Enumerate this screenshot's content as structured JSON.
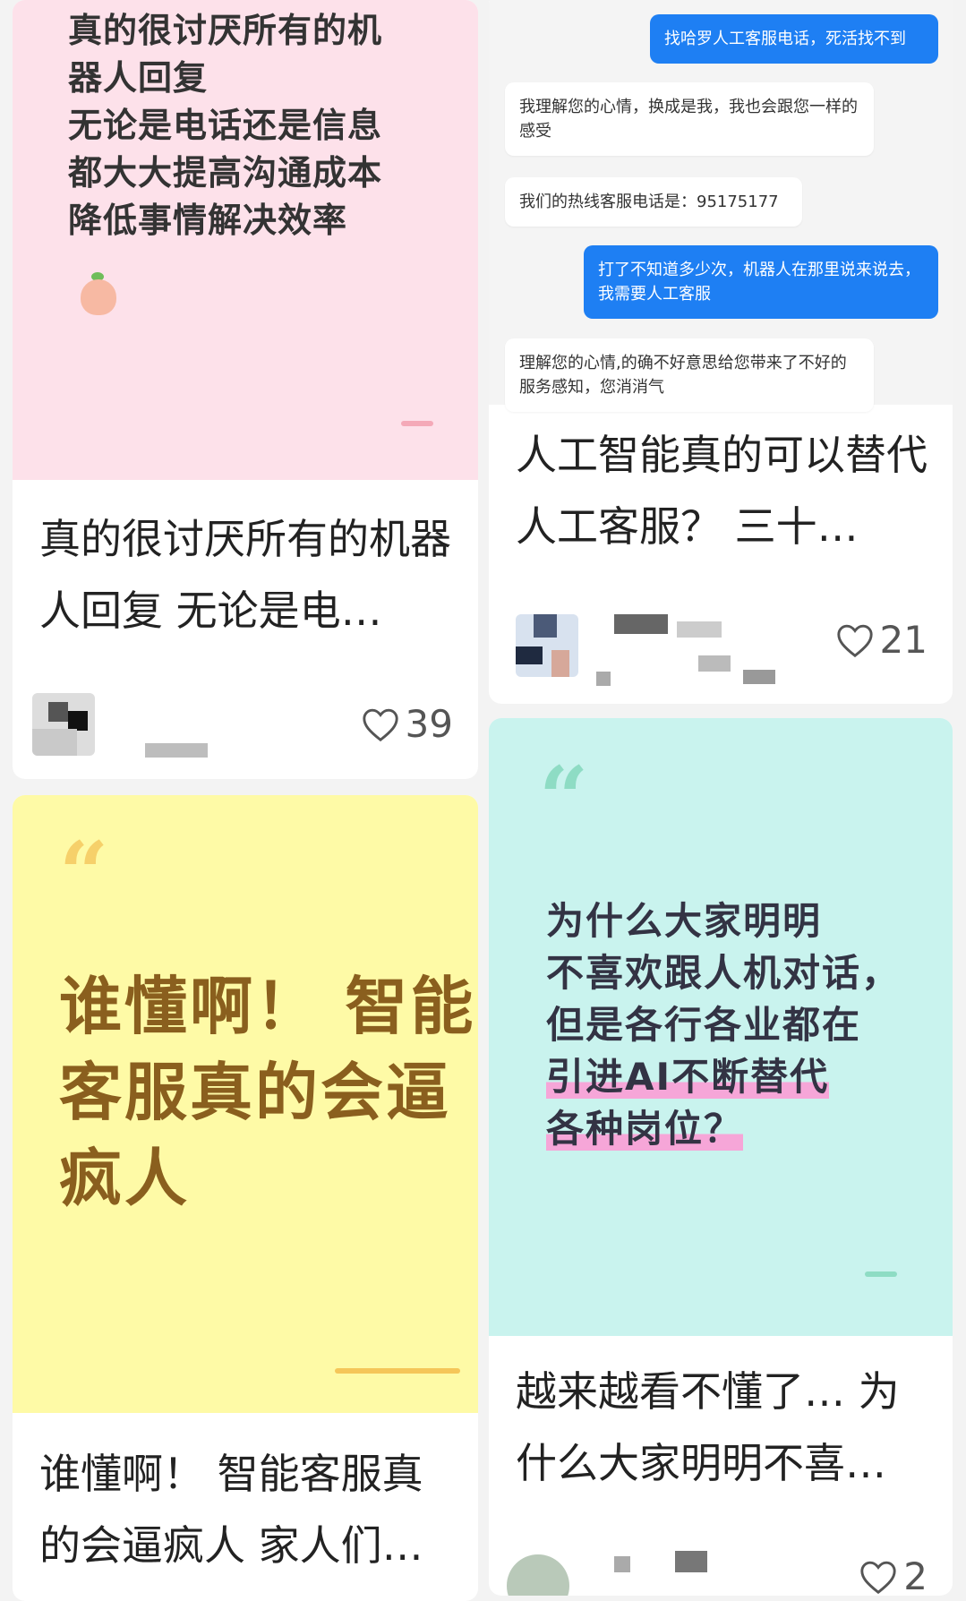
{
  "cards": [
    {
      "cover_lines": [
        "真的很讨厌所有的机",
        "器人回复",
        "无论是电话还是信息",
        "都大大提高沟通成本",
        " 降低事情解决效率"
      ],
      "title": "真的很讨厌所有的机器人回复 无论是电…",
      "likes": "39"
    },
    {
      "chat": [
        {
          "from": "me",
          "text": "找哈罗人工客服电话，死活找不到"
        },
        {
          "from": "bot",
          "text": "我理解您的心情，换成是我，我也会跟您一样的感受"
        },
        {
          "from": "bot",
          "text": "我们的热线客服电话是：95175177"
        },
        {
          "from": "me",
          "text": "打了不知道多少次，机器人在那里说来说去，我需要人工客服"
        },
        {
          "from": "bot",
          "text": "理解您的心情,的确不好意思给您带来了不好的服务感知，您消消气"
        }
      ],
      "title": "人工智能真的可以替代人工客服？ 三十…",
      "likes": "21"
    },
    {
      "cover_lines": [
        "谁懂啊！ 智能",
        "客服真的会逼",
        "疯人"
      ],
      "title": "谁懂啊！ 智能客服真的会逼疯人 家人们…",
      "colors": {
        "bg": "#fefaa6",
        "text": "#8a5f1e"
      }
    },
    {
      "cover_lines": [
        "为什么大家明明",
        "不喜欢跟人机对话，",
        "但是各行各业都在",
        "引进AI不断替代",
        "各种岗位？"
      ],
      "title": "越来越看不懂了… 为什么大家明明不喜…",
      "likes": "2",
      "colors": {
        "bg": "#c9f3ee"
      }
    }
  ],
  "icons": {
    "like": "heart-outline-icon",
    "emoji": "peach-face-emoji-icon",
    "quote": "quote-mark-icon"
  }
}
